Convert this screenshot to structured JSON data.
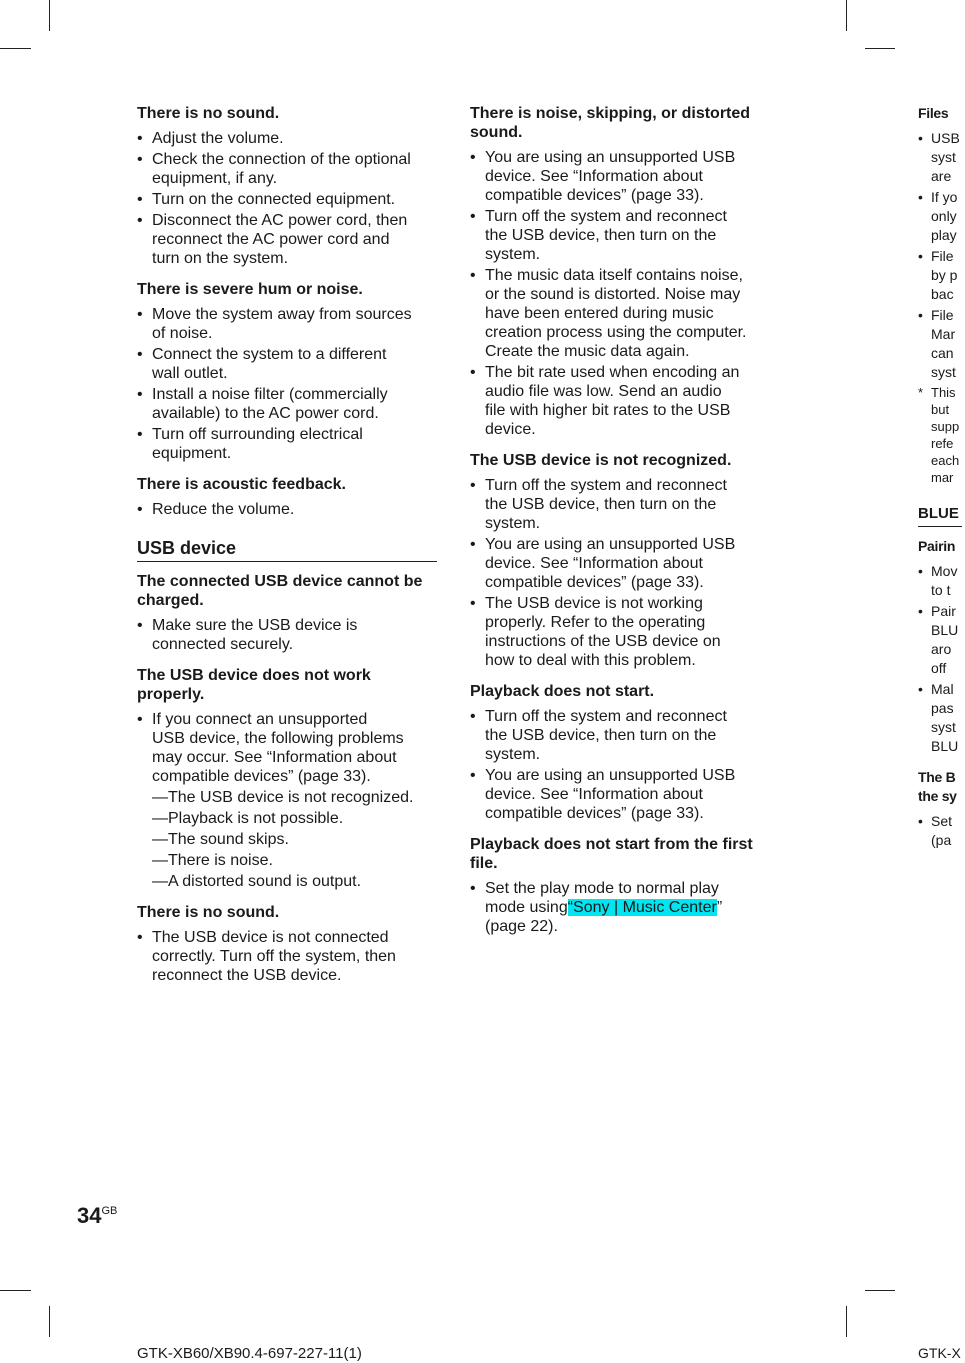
{
  "columns": [
    [
      {
        "t": "h",
        "text": "There is no sound."
      },
      {
        "t": "li",
        "text": "Adjust the volume."
      },
      {
        "t": "li",
        "text": "Check the connection of the optional\nequipment, if any."
      },
      {
        "t": "li",
        "text": "Turn on the connected equipment."
      },
      {
        "t": "li",
        "text": "Disconnect the AC power cord, then\nreconnect the AC power cord and\nturn on the system."
      },
      {
        "t": "gap"
      },
      {
        "t": "h",
        "text": "There is severe hum or noise."
      },
      {
        "t": "li",
        "text": "Move the system away from sources\nof noise."
      },
      {
        "t": "li",
        "text": "Connect the system to a different\nwall outlet."
      },
      {
        "t": "li",
        "text": "Install a noise filter (commercially\navailable) to the AC power cord."
      },
      {
        "t": "li",
        "text": "Turn off surrounding electrical\nequipment."
      },
      {
        "t": "gap"
      },
      {
        "t": "h",
        "text": "There is acoustic feedback."
      },
      {
        "t": "li",
        "text": "Reduce the volume."
      },
      {
        "t": "gap"
      },
      {
        "t": "sec",
        "text": "USB device"
      },
      {
        "t": "h",
        "text": "The connected USB device cannot be\ncharged."
      },
      {
        "t": "li",
        "text": "Make sure the USB device is\nconnected securely."
      },
      {
        "t": "gap"
      },
      {
        "t": "h",
        "text": "The USB device does not work\nproperly."
      },
      {
        "t": "li",
        "text": "If you connect an unsupported\nUSB device, the following problems\nmay occur. See “Information about\ncompatible devices” (page 33)."
      },
      {
        "t": "sub",
        "text": "—The USB device is not recognized."
      },
      {
        "t": "sub",
        "text": "—Playback is not possible."
      },
      {
        "t": "sub",
        "text": "—The sound skips."
      },
      {
        "t": "sub",
        "text": "—There is noise."
      },
      {
        "t": "sub",
        "text": "—A distorted sound is output."
      },
      {
        "t": "gap"
      },
      {
        "t": "h",
        "text": "There is no sound."
      },
      {
        "t": "li",
        "text": "The USB device is not connected\ncorrectly. Turn off the system, then\nreconnect the USB device."
      }
    ],
    [
      {
        "t": "h",
        "text": "There is noise, skipping, or distorted\nsound."
      },
      {
        "t": "li",
        "text": "You are using an unsupported USB\ndevice. See “Information about\ncompatible devices” (page 33)."
      },
      {
        "t": "li",
        "text": "Turn off the system and reconnect\nthe USB device, then turn on the\nsystem."
      },
      {
        "t": "li",
        "text": "The music data itself contains noise,\nor the sound is distorted. Noise may\nhave been entered during music\ncreation process using the computer.\nCreate the music data again."
      },
      {
        "t": "li",
        "text": "The bit rate used when encoding an\naudio file was low. Send an audio\nfile with higher bit rates to the USB\ndevice."
      },
      {
        "t": "gap"
      },
      {
        "t": "h",
        "text": "The USB device is not recognized."
      },
      {
        "t": "li",
        "text": "Turn off the system and reconnect\nthe USB device, then turn on the\nsystem."
      },
      {
        "t": "li",
        "text": "You are using an unsupported USB\ndevice. See “Information about\ncompatible devices” (page 33)."
      },
      {
        "t": "li",
        "text": "The USB device is not working\nproperly. Refer to the operating\ninstructions of the USB device on\nhow to deal with this problem."
      },
      {
        "t": "gap"
      },
      {
        "t": "h",
        "text": "Playback does not start."
      },
      {
        "t": "li",
        "text": "Turn off the system and reconnect\nthe USB device, then turn on the\nsystem."
      },
      {
        "t": "li",
        "text": "You are using an unsupported USB\ndevice. See “Information about\ncompatible devices” (page 33)."
      },
      {
        "t": "gap"
      },
      {
        "t": "h",
        "text": "Playback does not start from the first\nfile."
      },
      {
        "t": "li",
        "text": "Set the play mode to normal play\nmode using",
        "hl": "“Sony | Music Center",
        "after": "”\n(page 22)."
      }
    ],
    [
      {
        "t": "h",
        "text": "Files"
      },
      {
        "t": "li",
        "text": "USB\nsyst\nare"
      },
      {
        "t": "li",
        "text": "If yo\nonly\nplay"
      },
      {
        "t": "li",
        "text": "File\nby p\nbac"
      },
      {
        "t": "li",
        "text": "File\nMar\ncan\nsyst"
      },
      {
        "t": "note",
        "text": "This\nbut\nsupp\nrefe\neach\nmar"
      },
      {
        "t": "gap"
      },
      {
        "t": "sec",
        "text": "BLUE"
      },
      {
        "t": "h",
        "text": "Pairin"
      },
      {
        "t": "li",
        "text": "Mov\nto t"
      },
      {
        "t": "li",
        "text": "Pair\nBLU\naro\noff"
      },
      {
        "t": "li",
        "text": "Mal\npas\nsyst\nBLU"
      },
      {
        "t": "gap"
      },
      {
        "t": "h",
        "text": "The B\nthe sy"
      },
      {
        "t": "li",
        "text": "Set\n(pa"
      }
    ]
  ],
  "page_number": "34",
  "page_number_suffix": "GB",
  "footer_left": "GTK-XB60/XB90.4-697-227-11(1)",
  "footer_right": "GTK-X",
  "colors": {
    "highlight": "#00e5f0",
    "text": "#1a1a1a"
  }
}
